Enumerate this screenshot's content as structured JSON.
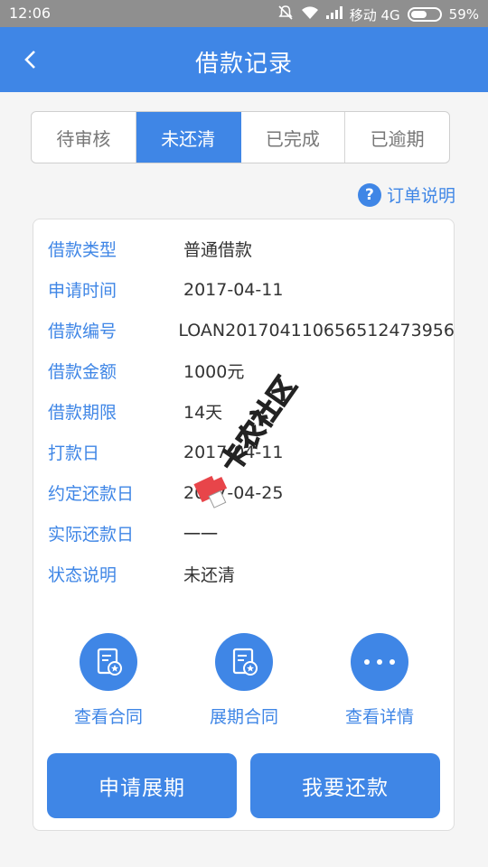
{
  "status_bar": {
    "time": "12:06",
    "carrier": "移动 4G",
    "battery": "59%",
    "battery_level": 0.59
  },
  "header": {
    "title": "借款记录",
    "back_icon": "chevron-left-icon"
  },
  "tabs": [
    {
      "label": "待审核",
      "active": false
    },
    {
      "label": "未还清",
      "active": true
    },
    {
      "label": "已完成",
      "active": false
    },
    {
      "label": "已逾期",
      "active": false
    }
  ],
  "order_explain": {
    "icon": "question-icon",
    "label": "订单说明"
  },
  "details": [
    {
      "label": "借款类型",
      "value": "普通借款"
    },
    {
      "label": "申请时间",
      "value": "2017-04-11"
    },
    {
      "label": "借款编号",
      "value": "LOAN201704110656512473956"
    },
    {
      "label": "借款金额",
      "value": "1000元"
    },
    {
      "label": "借款期限",
      "value": "14天"
    },
    {
      "label": "打款日",
      "value": "2017-04-11"
    },
    {
      "label": "约定还款日",
      "value": "2017-04-25"
    },
    {
      "label": "实际还款日",
      "value": "一一"
    },
    {
      "label": "状态说明",
      "value": "未还清"
    }
  ],
  "actions": [
    {
      "label": "查看合同",
      "icon": "contract-icon"
    },
    {
      "label": "展期合同",
      "icon": "contract-icon"
    },
    {
      "label": "查看详情",
      "icon": "more-icon"
    }
  ],
  "buttons": {
    "apply_extension": "申请展期",
    "repay": "我要还款"
  },
  "watermark": {
    "text": "卡农社区"
  },
  "colors": {
    "primary": "#3f86e6",
    "status_bar": "#8f8f8f",
    "background": "#f5f5f5",
    "watermark_red": "#e8454a"
  }
}
